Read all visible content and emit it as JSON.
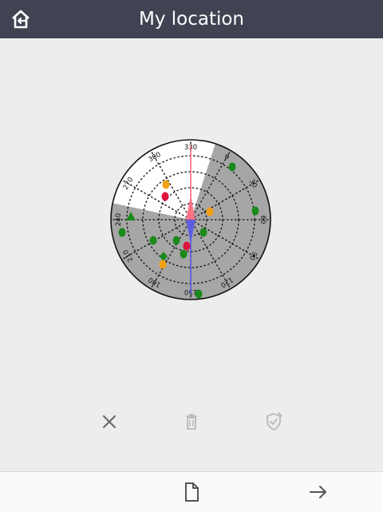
{
  "header": {
    "title": "My location",
    "home_icon": "home-exit-icon",
    "background": "#404352"
  },
  "skyplot": {
    "azimuth_labels": [
      "330",
      "0",
      "30",
      "60",
      "90",
      "120",
      "150",
      "180",
      "210",
      "240",
      "270",
      "300"
    ],
    "colors": {
      "plot_bg": "#ffffff",
      "obstructed": "#a6a6a6",
      "compass_north": "#ff6b7f",
      "compass_south": "#5a5ae6",
      "sat_green": "#1a8a1a",
      "sat_orange": "#f0a014",
      "sat_red": "#dc143c"
    }
  },
  "actions": {
    "cancel_icon": "close-icon",
    "delete_icon": "trash-icon",
    "confirm_icon": "shield-check-edit-icon"
  },
  "bottom_bar": {
    "document_icon": "document-icon",
    "next_icon": "arrow-right-icon"
  }
}
